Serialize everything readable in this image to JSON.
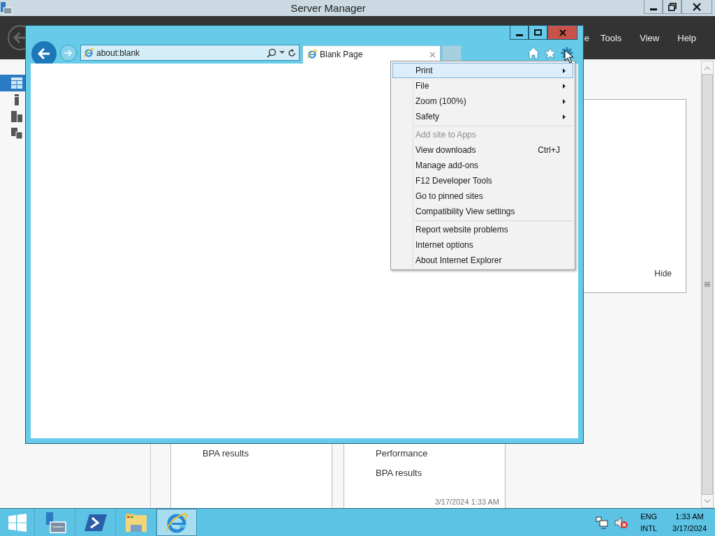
{
  "server_manager": {
    "title": "Server Manager",
    "menu": [
      "e",
      "Tools",
      "View",
      "Help"
    ],
    "nav": [
      {
        "kind": "dashboard",
        "selected": true
      },
      {
        "kind": "server",
        "selected": false
      },
      {
        "kind": "servers",
        "selected": false
      },
      {
        "kind": "group",
        "selected": false
      }
    ],
    "tile": {
      "action": "Hide"
    },
    "cards": [
      {
        "items": [
          "BPA results"
        ]
      },
      {
        "items": [
          "Performance",
          "BPA results"
        ],
        "timestamp": "3/17/2024 1:33 AM"
      }
    ]
  },
  "browser": {
    "address": "about:blank",
    "tabs": [
      {
        "title": "Blank Page",
        "selected": true
      }
    ],
    "menu": {
      "groups": [
        [
          {
            "label": "Print",
            "submenu": true,
            "disabled": false,
            "selected": true
          },
          {
            "label": "File",
            "submenu": true,
            "disabled": false,
            "selected": false
          },
          {
            "label": "Zoom (100%)",
            "submenu": true,
            "disabled": false,
            "selected": false
          },
          {
            "label": "Safety",
            "submenu": true,
            "disabled": false,
            "selected": false
          }
        ],
        [
          {
            "label": "Add site to Apps",
            "submenu": false,
            "disabled": true,
            "selected": false
          },
          {
            "label": "View downloads",
            "shortcut": "Ctrl+J",
            "submenu": false,
            "disabled": false,
            "selected": false
          },
          {
            "label": "Manage add-ons",
            "submenu": false,
            "disabled": false,
            "selected": false
          },
          {
            "label": "F12 Developer Tools",
            "submenu": false,
            "disabled": false,
            "selected": false
          },
          {
            "label": "Go to pinned sites",
            "submenu": false,
            "disabled": false,
            "selected": false
          },
          {
            "label": "Compatibility View settings",
            "submenu": false,
            "disabled": false,
            "selected": false
          }
        ],
        [
          {
            "label": "Report website problems",
            "submenu": false,
            "disabled": false,
            "selected": false
          },
          {
            "label": "Internet options",
            "submenu": false,
            "disabled": false,
            "selected": false
          },
          {
            "label": "About Internet Explorer",
            "submenu": false,
            "disabled": false,
            "selected": false
          }
        ]
      ]
    }
  },
  "taskbar": {
    "apps": [
      {
        "kind": "server",
        "active": false
      },
      {
        "kind": "powershell",
        "active": false
      },
      {
        "kind": "explorer",
        "active": false
      },
      {
        "kind": "ie",
        "active": true
      }
    ],
    "tray": {
      "language": "ENG",
      "layout": "INTL",
      "time": "1:33 AM",
      "date": "3/17/2024"
    }
  }
}
